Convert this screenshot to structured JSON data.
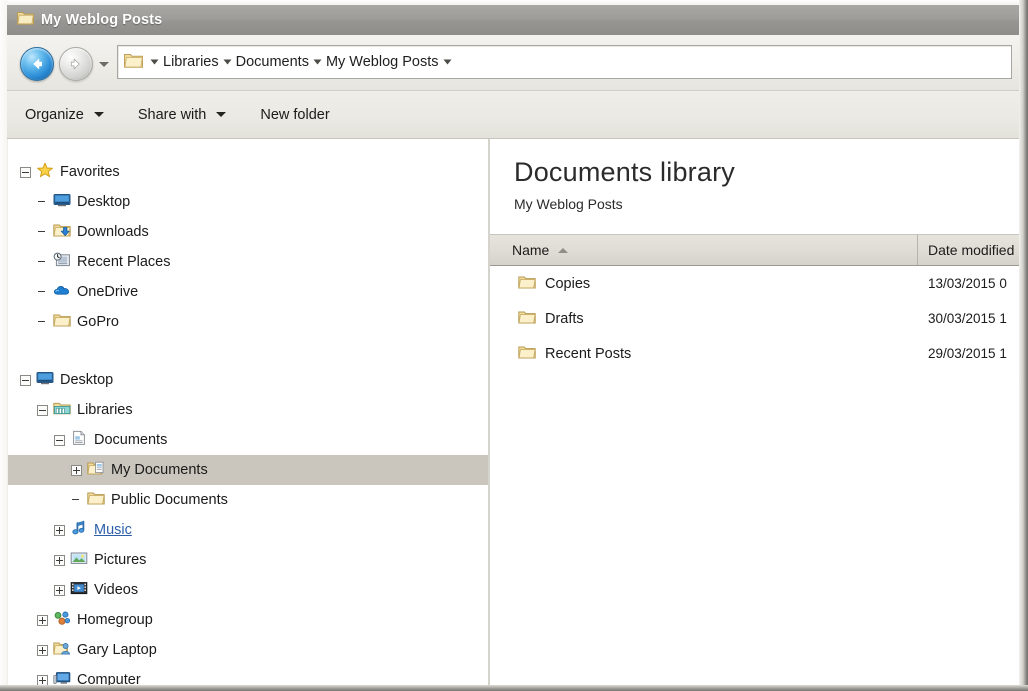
{
  "window": {
    "title": "My Weblog Posts",
    "title_icon": "folder-icon"
  },
  "address_bar": {
    "back_button": "back-icon",
    "forward_button": "forward-icon",
    "history_dropdown": "chevron-down-icon",
    "breadcrumb": {
      "root_icon": "folder-icon",
      "items": [
        "Libraries",
        "Documents",
        "My Weblog Posts"
      ]
    }
  },
  "command_bar": {
    "items": [
      {
        "label": "Organize",
        "has_caret": true
      },
      {
        "label": "Share with",
        "has_caret": true
      },
      {
        "label": "New folder",
        "has_caret": false
      }
    ]
  },
  "nav_pane": {
    "groups": [
      {
        "name": "favorites",
        "items": [
          {
            "label": "Favorites",
            "icon": "star-icon",
            "indent": 0,
            "twist": "minus",
            "selected": false,
            "hover": false
          },
          {
            "label": "Desktop",
            "icon": "desktop-icon",
            "indent": 1,
            "twist": "none",
            "selected": false,
            "hover": false
          },
          {
            "label": "Downloads",
            "icon": "downloads-icon",
            "indent": 1,
            "twist": "none",
            "selected": false,
            "hover": false
          },
          {
            "label": "Recent Places",
            "icon": "recent-places-icon",
            "indent": 1,
            "twist": "none",
            "selected": false,
            "hover": false
          },
          {
            "label": "OneDrive",
            "icon": "cloud-icon",
            "indent": 1,
            "twist": "none",
            "selected": false,
            "hover": false
          },
          {
            "label": "GoPro",
            "icon": "folder-icon",
            "indent": 1,
            "twist": "none",
            "selected": false,
            "hover": false
          }
        ]
      },
      {
        "name": "desktop",
        "items": [
          {
            "label": "Desktop",
            "icon": "desktop-icon",
            "indent": 0,
            "twist": "minus",
            "selected": false,
            "hover": false
          },
          {
            "label": "Libraries",
            "icon": "library-icon",
            "indent": 1,
            "twist": "minus",
            "selected": false,
            "hover": false
          },
          {
            "label": "Documents",
            "icon": "document-icon",
            "indent": 2,
            "twist": "minus",
            "selected": false,
            "hover": false
          },
          {
            "label": "My Documents",
            "icon": "my-documents-icon",
            "indent": 3,
            "twist": "plus",
            "selected": true,
            "hover": false
          },
          {
            "label": "Public Documents",
            "icon": "folder-icon",
            "indent": 3,
            "twist": "none",
            "selected": false,
            "hover": false
          },
          {
            "label": "Music",
            "icon": "music-icon",
            "indent": 2,
            "twist": "plus",
            "selected": false,
            "hover": true
          },
          {
            "label": "Pictures",
            "icon": "pictures-icon",
            "indent": 2,
            "twist": "plus",
            "selected": false,
            "hover": false
          },
          {
            "label": "Videos",
            "icon": "videos-icon",
            "indent": 2,
            "twist": "plus",
            "selected": false,
            "hover": false
          },
          {
            "label": "Homegroup",
            "icon": "homegroup-icon",
            "indent": 1,
            "twist": "plus",
            "selected": false,
            "hover": false
          },
          {
            "label": "Gary Laptop",
            "icon": "user-folder-icon",
            "indent": 1,
            "twist": "plus",
            "selected": false,
            "hover": false
          },
          {
            "label": "Computer",
            "icon": "computer-icon",
            "indent": 1,
            "twist": "plus",
            "selected": false,
            "hover": false
          }
        ]
      }
    ]
  },
  "content": {
    "header_title": "Documents library",
    "header_subtitle": "My Weblog Posts",
    "columns": [
      {
        "key": "name",
        "label": "Name",
        "sorted": true,
        "sort_direction": "asc"
      },
      {
        "key": "date",
        "label": "Date modified",
        "sorted": false,
        "sort_direction": ""
      }
    ],
    "rows": [
      {
        "icon": "folder-icon",
        "name": "Copies",
        "date": "13/03/2015 0"
      },
      {
        "icon": "folder-icon",
        "name": "Drafts",
        "date": "30/03/2015 1"
      },
      {
        "icon": "folder-icon",
        "name": "Recent Posts",
        "date": "29/03/2015 1"
      }
    ]
  },
  "colors": {
    "titlebar": "#9d9c98",
    "selection": "#cac6bd",
    "hover_link": "#2d5fa8",
    "folder_yellow": "#f2dd9a",
    "accent_blue": "#2d8fd8"
  }
}
